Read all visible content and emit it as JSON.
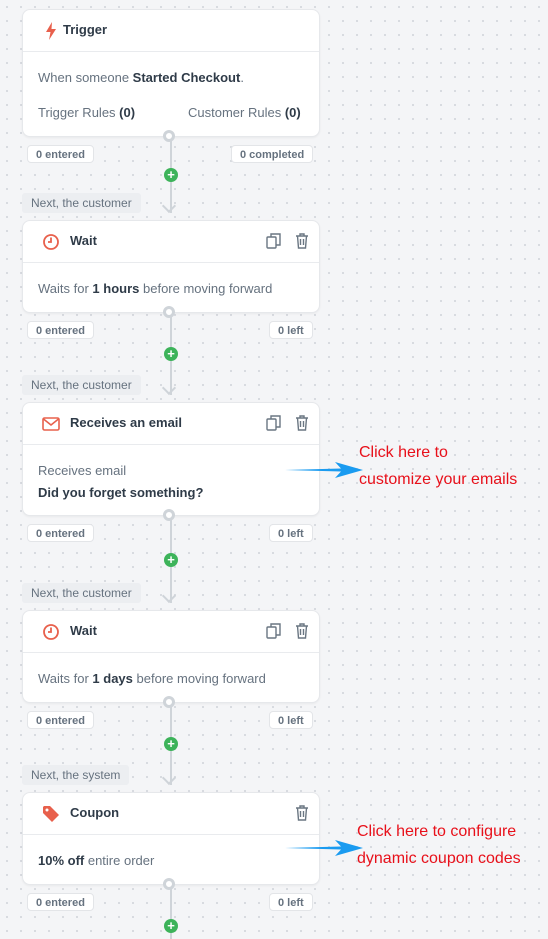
{
  "trigger": {
    "title": "Trigger",
    "desc_prefix": "When someone ",
    "desc_event": "Started Checkout",
    "desc_suffix": ".",
    "trigger_rules_label": "Trigger Rules",
    "trigger_rules_count": "(0)",
    "customer_rules_label": "Customer Rules",
    "customer_rules_count": "(0)",
    "entered": "0 entered",
    "completed": "0 completed"
  },
  "steps": [
    {
      "type": "wait",
      "label_before": "Next, the customer",
      "title": "Wait",
      "body_prefix": "Waits for ",
      "body_value": "1 hours",
      "body_suffix": " before moving forward",
      "entered": "0 entered",
      "left": "0 left"
    },
    {
      "type": "email",
      "label_before": "Next, the customer",
      "title": "Receives an email",
      "body_line1": "Receives email",
      "body_line2": "Did you forget something?",
      "entered": "0 entered",
      "left": "0 left"
    },
    {
      "type": "wait",
      "label_before": "Next, the customer",
      "title": "Wait",
      "body_prefix": "Waits for ",
      "body_value": "1 days",
      "body_suffix": " before moving forward",
      "entered": "0 entered",
      "left": "0 left"
    },
    {
      "type": "coupon",
      "label_before": "Next, the system",
      "title": "Coupon",
      "body_value": "10% off",
      "body_suffix": " entire order",
      "entered": "0 entered",
      "left": "0 left"
    }
  ],
  "annotations": {
    "email": [
      "Click here to",
      "customize your emails"
    ],
    "coupon": [
      "Click here to configure",
      "dynamic coupon codes"
    ]
  },
  "icons": {
    "trigger": "lightning-icon",
    "wait": "clock-icon",
    "email": "envelope-icon",
    "coupon": "tag-icon",
    "duplicate": "duplicate-icon",
    "delete": "trash-icon",
    "add": "plus-icon"
  },
  "colors": {
    "accent": "#e8604c",
    "add": "#3db35a",
    "annotation_text": "#e8101a",
    "annotation_arrow": "#1a9bf0"
  }
}
